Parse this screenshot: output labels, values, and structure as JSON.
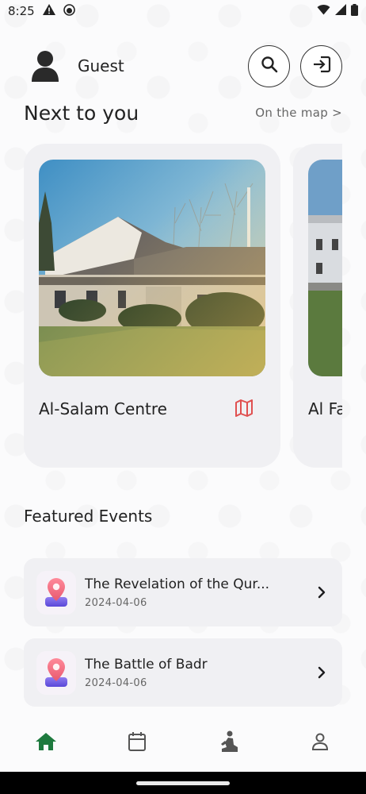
{
  "status_bar": {
    "time": "8:25"
  },
  "header": {
    "user_name": "Guest"
  },
  "nearby": {
    "title": "Next to you",
    "map_link": "On the map >",
    "places": [
      {
        "name": "Al-Salam Centre"
      },
      {
        "name": "Al Fa"
      }
    ]
  },
  "featured": {
    "title": "Featured Events",
    "events": [
      {
        "title": "The Revelation of the Qur...",
        "date": "2024-04-06"
      },
      {
        "title": "The Battle of Badr",
        "date": "2024-04-06"
      }
    ]
  },
  "bottom_nav": {
    "items": [
      {
        "icon": "home-icon",
        "active": true
      },
      {
        "icon": "calendar-icon",
        "active": false
      },
      {
        "icon": "prayer-icon",
        "active": false
      },
      {
        "icon": "profile-icon",
        "active": false
      }
    ]
  },
  "colors": {
    "accent_green": "#1e7a3e",
    "map_icon_red": "#e05050",
    "card_bg": "#f0f0f3"
  }
}
